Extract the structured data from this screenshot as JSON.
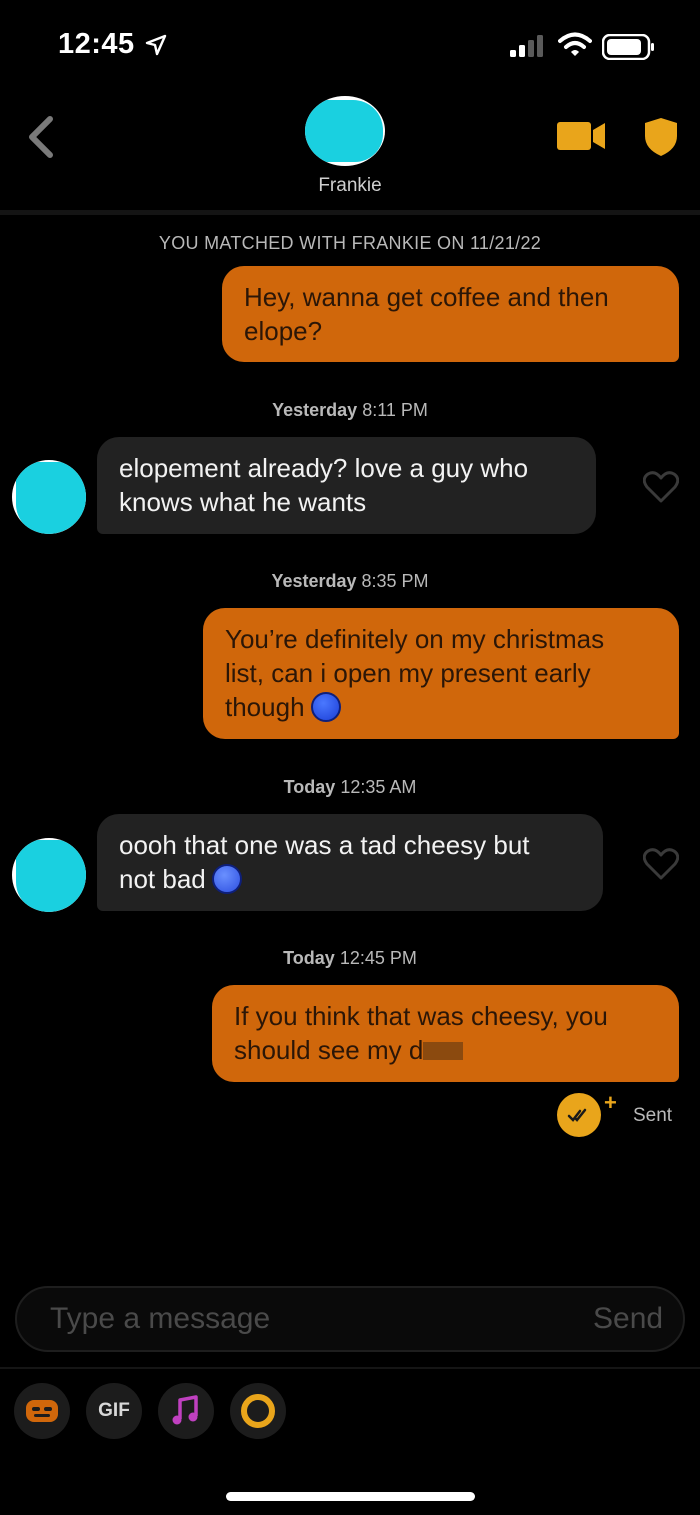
{
  "status_bar": {
    "time": "12:45"
  },
  "header": {
    "contact_name": "Frankie"
  },
  "match_notice": "YOU MATCHED WITH FRANKIE ON 11/21/22",
  "messages": [
    {
      "type": "timestamp",
      "day": "",
      "time": ""
    },
    {
      "type": "outgoing",
      "lines": [
        "Hey, wanna get coffee and then",
        "elope?"
      ]
    },
    {
      "type": "timestamp",
      "day": "Yesterday",
      "time": "8:11 PM"
    },
    {
      "type": "incoming",
      "lines": [
        "elopement already? love a guy who",
        "knows what he wants"
      ]
    },
    {
      "type": "timestamp",
      "day": "Yesterday",
      "time": "8:35 PM"
    },
    {
      "type": "outgoing",
      "lines": [
        "You’re definitely on my christmas",
        "list, can i open my present early",
        "though"
      ],
      "emoji": "smirk-icon"
    },
    {
      "type": "timestamp",
      "day": "Today",
      "time": "12:35 AM"
    },
    {
      "type": "incoming",
      "lines": [
        "oooh that one was a tad cheesy but",
        "not bad"
      ],
      "emoji": "laughing-icon"
    },
    {
      "type": "timestamp",
      "day": "Today",
      "time": "12:45 PM"
    },
    {
      "type": "outgoing",
      "lines": [
        "If you think that was cheesy, you",
        "should see my d"
      ]
    }
  ],
  "receipt": {
    "plus": "+",
    "label": "Sent"
  },
  "composer": {
    "placeholder": "Type a message",
    "send_label": "Send"
  },
  "toolbar": {
    "gif_label": "GIF"
  },
  "colors": {
    "outgoing_bubble": "#d0670b",
    "incoming_bubble": "#222222",
    "accent": "#e9a51b"
  }
}
